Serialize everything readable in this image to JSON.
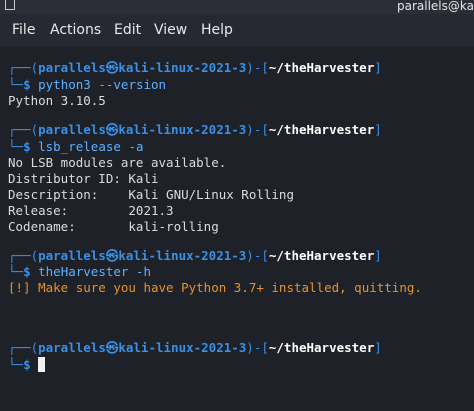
{
  "titlebar": {
    "user_host": "parallels@ka"
  },
  "menu": {
    "items": [
      "File",
      "Actions",
      "Edit",
      "View",
      "Help"
    ]
  },
  "prompt": {
    "corner_top": "┌──(",
    "user": "parallels",
    "at": "㉿",
    "host": "kali-linux-2021-3",
    "close_paren": ")-[",
    "path": "~/theHarvester",
    "close_bracket": "]",
    "corner_bottom": "└─",
    "dollar": "$"
  },
  "blocks": [
    {
      "command": "python3",
      "args": " --version",
      "output": [
        "Python 3.10.5"
      ]
    },
    {
      "command": "lsb_release",
      "args": " -a",
      "output": [
        "No LSB modules are available.",
        "Distributor ID: Kali",
        "Description:    Kali GNU/Linux Rolling",
        "Release:        2021.3",
        "Codename:       kali-rolling"
      ]
    },
    {
      "command": "theHarvester",
      "args": " -h",
      "warning": "[!] Make sure you have Python 3.7+ installed, quitting."
    }
  ]
}
